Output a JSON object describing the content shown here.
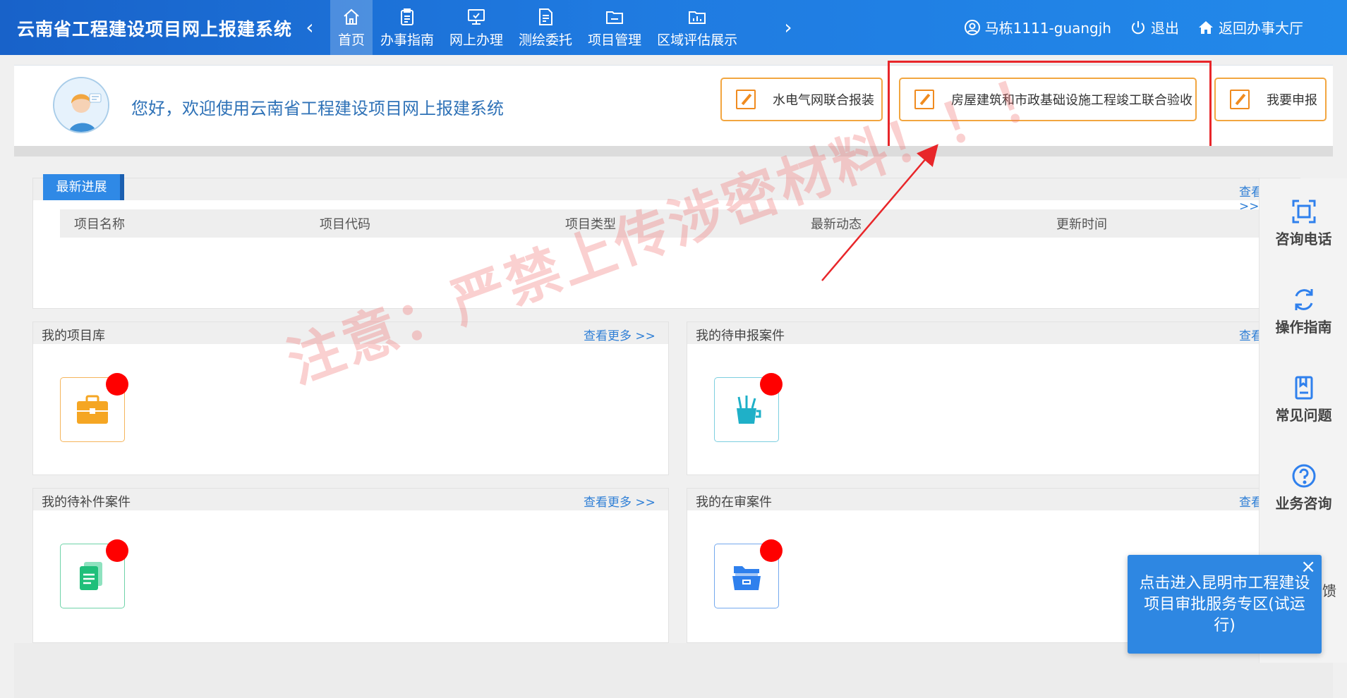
{
  "header": {
    "brand": "云南省工程建设项目网上报建系统",
    "prev": "‹",
    "next": "›",
    "nav": [
      {
        "label": "首页",
        "icon": "home-icon",
        "active": true
      },
      {
        "label": "办事指南",
        "icon": "clipboard-icon"
      },
      {
        "label": "网上办理",
        "icon": "monitor-icon"
      },
      {
        "label": "测绘委托",
        "icon": "survey-document-icon"
      },
      {
        "label": "项目管理",
        "icon": "folder-icon"
      },
      {
        "label": "区域评估展示",
        "icon": "folder-chart-icon"
      }
    ],
    "user": "马栋1111-guangjh",
    "logout": "退出",
    "back_hall": "返回办事大厅"
  },
  "welcome": {
    "text": "您好，欢迎使用云南省工程建设项目网上报建系统",
    "buttons": {
      "water": "水电气网联合报装",
      "house": "房屋建筑和市政基础设施工程竣工联合验收",
      "apply": "我要申报"
    }
  },
  "latest": {
    "tag": "最新进展",
    "more": "查看更多 >>",
    "columns": [
      "项目名称",
      "项目代码",
      "项目类型",
      "最新动态",
      "更新时间"
    ]
  },
  "panels": {
    "library": {
      "title": "我的项目库",
      "more": "查看更多 >>"
    },
    "pending": {
      "title": "我的待申报案件",
      "more": "查看更多 >>"
    },
    "supplement": {
      "title": "我的待补件案件",
      "more": "查看更多 >>"
    },
    "review": {
      "title": "我的在审案件",
      "more": "查看更"
    }
  },
  "watermark": "注意：严禁上传涉密材料！！！",
  "sidebar": [
    {
      "label": "咨询电话",
      "icon": "phone-frame-icon"
    },
    {
      "label": "操作指南",
      "icon": "refresh-icon"
    },
    {
      "label": "常见问题",
      "icon": "book-icon"
    },
    {
      "label": "业务咨询",
      "icon": "question-icon"
    }
  ],
  "popup": {
    "text": "点击进入昆明市工程建设项目审批服务专区(试运行)",
    "close": "×",
    "peek_char": "馈"
  },
  "colors": {
    "header": "#1f7ae0",
    "accent_orange": "#f2a640",
    "highlight_red": "#e8262a",
    "link_blue": "#2f7fd6"
  }
}
